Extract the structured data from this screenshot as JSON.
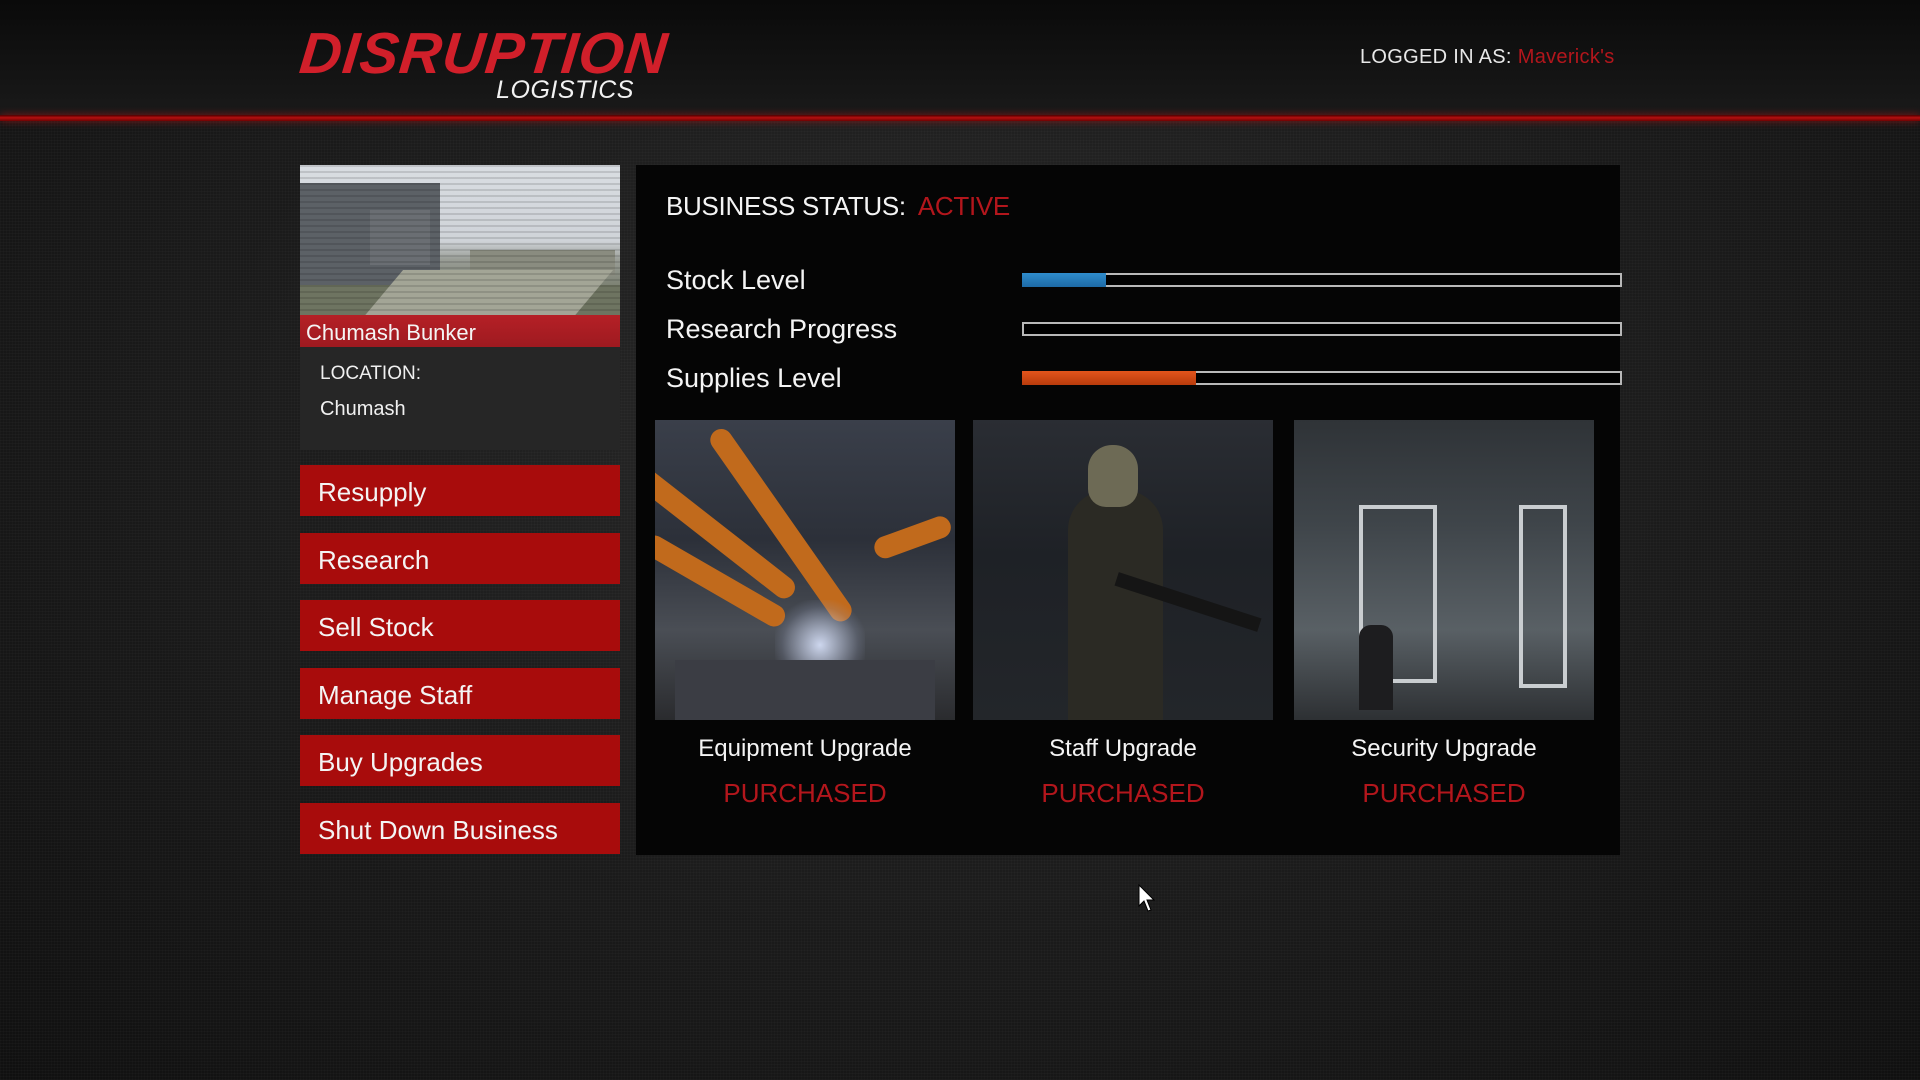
{
  "header": {
    "logo_main": "DISRUPTION",
    "logo_sub": "LOGISTICS",
    "logged_in_label": "LOGGED IN AS:",
    "logged_in_user": "Maverick's"
  },
  "property": {
    "name": "Chumash Bunker",
    "location_label": "LOCATION:",
    "location_value": "Chumash"
  },
  "menu": {
    "items": [
      {
        "label": "Resupply"
      },
      {
        "label": "Research"
      },
      {
        "label": "Sell Stock"
      },
      {
        "label": "Manage Staff"
      },
      {
        "label": "Buy Upgrades"
      },
      {
        "label": "Shut Down Business"
      }
    ]
  },
  "business": {
    "status_label": "BUSINESS STATUS:",
    "status_value": "ACTIVE",
    "stats": [
      {
        "label": "Stock Level",
        "fraction": 0.14,
        "color": "#2a82c4"
      },
      {
        "label": "Research Progress",
        "fraction": 0.0,
        "color": "#2a82c4"
      },
      {
        "label": "Supplies Level",
        "fraction": 0.29,
        "color": "#d44a16"
      }
    ]
  },
  "upgrades": [
    {
      "name": "Equipment Upgrade",
      "state": "PURCHASED"
    },
    {
      "name": "Staff Upgrade",
      "state": "PURCHASED"
    },
    {
      "name": "Security Upgrade",
      "state": "PURCHASED"
    }
  ],
  "colors": {
    "brand_red": "#d11f2a",
    "button_red": "#a80c0c",
    "status_red": "#b3161c",
    "stock_blue": "#2a82c4",
    "supplies_orange": "#d44a16"
  }
}
